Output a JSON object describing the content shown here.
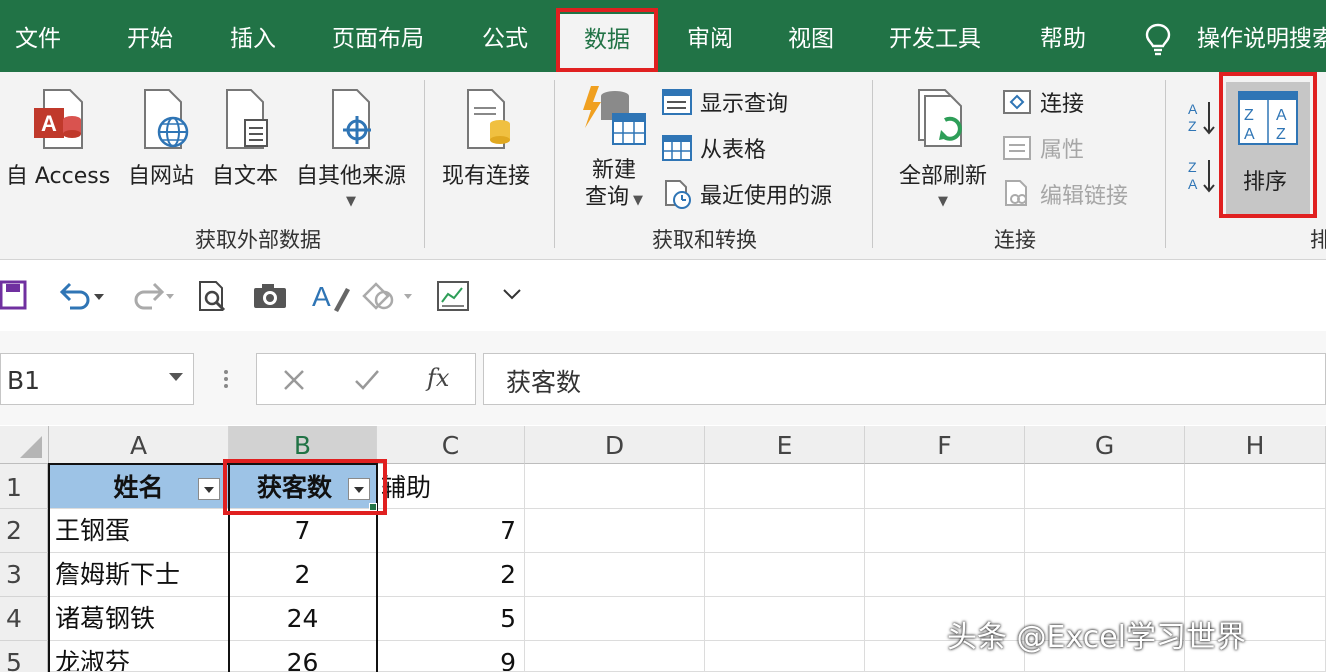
{
  "ribbon_tabs": [
    "文件",
    "开始",
    "插入",
    "页面布局",
    "公式",
    "数据",
    "审阅",
    "视图",
    "开发工具",
    "帮助"
  ],
  "active_tab": "数据",
  "tell_me": "操作说明搜索",
  "groups": {
    "external": {
      "label": "获取外部数据",
      "from_access": "自 Access",
      "from_web": "自网站",
      "from_text": "自文本",
      "from_other": "自其他来源",
      "existing": "现有连接"
    },
    "transform": {
      "label": "获取和转换",
      "new_query_1": "新建",
      "new_query_2": "查询",
      "show_queries": "显示查询",
      "from_table": "从表格",
      "recent_sources": "最近使用的源"
    },
    "connections": {
      "label": "连接",
      "refresh_all": "全部刷新",
      "connections": "连接",
      "properties": "属性",
      "edit_links": "编辑链接"
    },
    "sort": {
      "sort_label": "排序",
      "group_label_partial": "排"
    }
  },
  "formula_bar": {
    "name_box": "B1",
    "fx": "fx",
    "content": "获客数"
  },
  "columns": [
    "A",
    "B",
    "C",
    "D",
    "E",
    "F",
    "G",
    "H"
  ],
  "rows": [
    {
      "num": "1",
      "a": "姓名",
      "b": "获客数",
      "c": "辅助"
    },
    {
      "num": "2",
      "a": "王钢蛋",
      "b": "7",
      "c": "7"
    },
    {
      "num": "3",
      "a": "詹姆斯下士",
      "b": "2",
      "c": "2"
    },
    {
      "num": "4",
      "a": "诸葛钢铁",
      "b": "24",
      "c": "5"
    },
    {
      "num": "5",
      "a": "龙淑芬",
      "b": "26",
      "c": "9"
    }
  ],
  "watermark": "头条 @Excel学习世界",
  "colors": {
    "ribbon_green": "#217346",
    "header_fill": "#9dc3e6",
    "highlight_red": "#e02020"
  }
}
